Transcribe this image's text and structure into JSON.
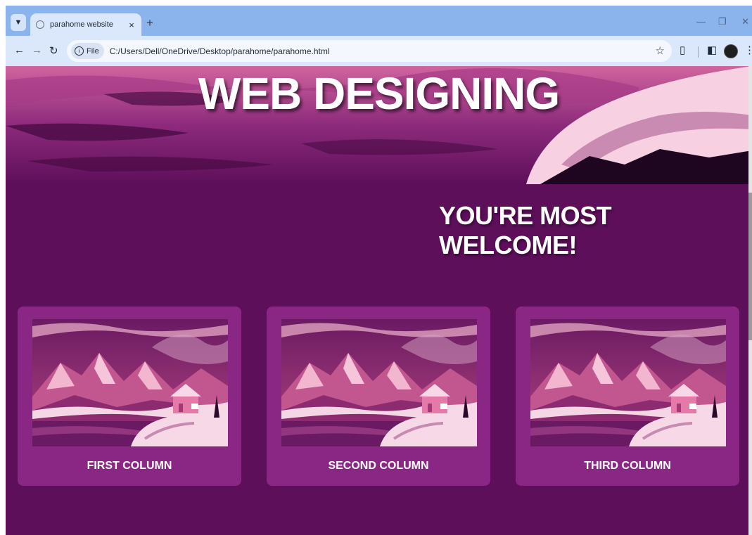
{
  "browser": {
    "tab_title": "parahome website",
    "tab_close": "×",
    "new_tab": "+",
    "address_chip": "File",
    "address_chip_icon": "i",
    "url": "C:/Users/Dell/OneDrive/Desktop/parahome/parahome.html",
    "icons": [
      "tab-list-icon",
      "back-icon",
      "forward-icon",
      "reload-icon",
      "info-icon",
      "star-icon",
      "extensions-icon",
      "side-panel-icon",
      "profile-icon",
      "menu-icon",
      "minimize-icon",
      "restore-icon",
      "close-icon"
    ]
  },
  "hero": {
    "title": "WEB DESIGNING"
  },
  "welcome": "YOU'RE MOST WELCOME!",
  "columns": [
    {
      "label": "FIRST COLUMN"
    },
    {
      "label": "SECOND COLUMN"
    },
    {
      "label": "THIRD COLUMN"
    }
  ],
  "colors": {
    "page_bg": "#5e0f5a",
    "card_bg": "#8a2683",
    "tabbar_bg": "#8cb4ec",
    "toolbar_bg": "#dbe7fb"
  }
}
